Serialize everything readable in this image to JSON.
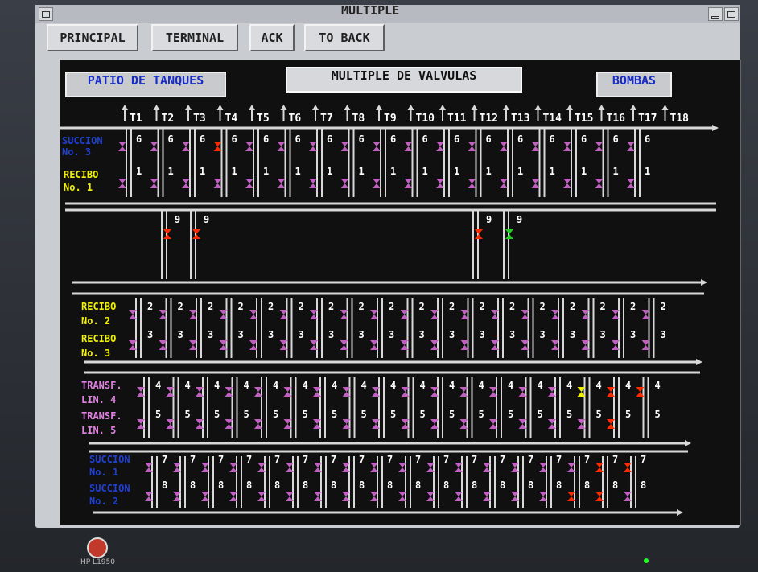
{
  "window": {
    "title": "MULTIPLE"
  },
  "menu": {
    "principal": "PRINCIPAL",
    "terminal": "TERMINAL",
    "ack": "ACK",
    "back": "TO BACK"
  },
  "header": {
    "left_button": "PATIO DE TANQUES",
    "title": "MULTIPLE DE VALVULAS",
    "right_button": "BOMBAS"
  },
  "tanks": [
    "T1",
    "T2",
    "T3",
    "T4",
    "T5",
    "T6",
    "T7",
    "T8",
    "T9",
    "T10",
    "T11",
    "T12",
    "T13",
    "T14",
    "T15",
    "T16",
    "T17",
    "T18"
  ],
  "colors": {
    "panel_bg": "#101010",
    "pipe": "#d8d8d8",
    "valve_normal": "#c060c0",
    "valve_alarm": "#ff2a00",
    "valve_open": "#20d020",
    "valve_warn": "#f0f000",
    "label_yellow": "#f0f000",
    "label_blue": "#2040d0",
    "label_pink": "#e080e0"
  },
  "groups": {
    "g1": {
      "label_top": [
        "SUCCION",
        "No. 3"
      ],
      "label_bottom": [
        "RECIBO",
        "No. 1"
      ],
      "num_top": "6",
      "num_bottom": "1"
    },
    "g9": {
      "num": "9"
    },
    "g2": {
      "label_top": [
        "RECIBO",
        "No. 2"
      ],
      "label_bottom": [
        "RECIBO",
        "No. 3"
      ],
      "num_top": "2",
      "num_bottom": "3"
    },
    "g3": {
      "label_top": [
        "TRANSF.",
        "LIN. 4"
      ],
      "label_bottom": [
        "TRANSF.",
        "LIN. 5"
      ],
      "num_top": "4",
      "num_bottom": "5"
    },
    "g4": {
      "label_top": [
        "SUCCION",
        "No. 1"
      ],
      "label_bottom": [
        "SUCCION",
        "No. 2"
      ],
      "num_top": "7",
      "num_bottom": "8"
    }
  },
  "valve_states": {
    "g1_top": [
      "normal",
      "normal",
      "normal",
      "alarm",
      "normal",
      "normal",
      "normal",
      "normal",
      "normal",
      "normal",
      "normal",
      "normal",
      "normal",
      "normal",
      "normal",
      "normal",
      "normal"
    ],
    "g9": [
      "alarm",
      "alarm",
      "alarm",
      "open"
    ],
    "g3_top": [
      "normal",
      "normal",
      "normal",
      "normal",
      "normal",
      "normal",
      "normal",
      "normal",
      "normal",
      "normal",
      "normal",
      "normal",
      "normal",
      "normal",
      "normal",
      "warn",
      "alarm",
      "alarm"
    ],
    "g3_bottom": [
      "normal",
      "normal",
      "normal",
      "normal",
      "normal",
      "normal",
      "normal",
      "normal",
      "normal",
      "normal",
      "normal",
      "normal",
      "normal",
      "normal",
      "normal",
      "normal",
      "alarm"
    ],
    "g4_top": [
      "normal",
      "normal",
      "normal",
      "normal",
      "normal",
      "normal",
      "normal",
      "normal",
      "normal",
      "normal",
      "normal",
      "normal",
      "normal",
      "normal",
      "normal",
      "normal",
      "alarm",
      "alarm"
    ],
    "g4_bottom": [
      "normal",
      "normal",
      "normal",
      "normal",
      "normal",
      "normal",
      "normal",
      "normal",
      "normal",
      "normal",
      "normal",
      "normal",
      "normal",
      "normal",
      "normal",
      "alarm",
      "alarm",
      "normal"
    ]
  },
  "monitor": {
    "brand": "HP L1950"
  }
}
